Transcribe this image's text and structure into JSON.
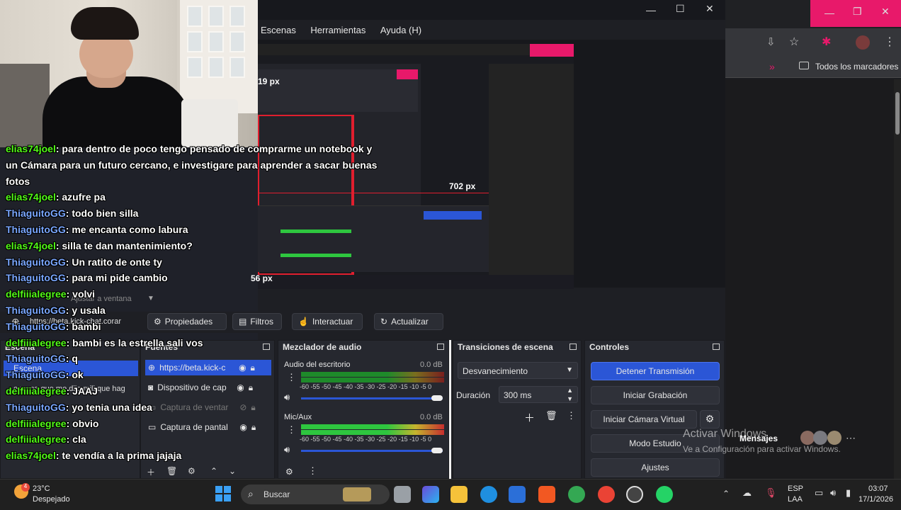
{
  "obs": {
    "menu": [
      "Escenas",
      "Herramientas",
      "Ayuda (H)"
    ],
    "measure_labels": {
      "left": "19 px",
      "right": "702 px",
      "bottom": "56 px"
    },
    "fit_label": "Ajustar a ventana",
    "source_url_label": "https://beta.kick-chat.corar",
    "toolbar": {
      "properties": "Propiedades",
      "filters": "Filtros",
      "interact": "Interactuar",
      "refresh": "Actualizar"
    },
    "scenes_panel": {
      "title": "Escena",
      "item": "Escena",
      "desc": "escena que me dijo mili que hag"
    },
    "sources_panel": {
      "title": "Fuentes",
      "items": [
        "https://beta.kick-c",
        "Dispositivo de cap",
        "Captura de ventar",
        "Captura de pantal"
      ]
    },
    "mixer": {
      "title": "Mezclador de audio",
      "channels": [
        {
          "name": "Audio del escritorio",
          "db": "0.0 dB"
        },
        {
          "name": "Mic/Aux",
          "db": "0.0 dB"
        }
      ],
      "scale": "-60 -55 -50 -45 -40 -35 -30 -25 -20 -15 -10 -5 0"
    },
    "transitions": {
      "title": "Transiciones de escena",
      "selected": "Desvanecimiento",
      "duration_label": "Duración",
      "duration_value": "300 ms"
    },
    "controls": {
      "title": "Controles",
      "stop_stream": "Detener Transmisión",
      "start_recording": "Iniciar Grabación",
      "virtual_cam": "Iniciar Cámara Virtual",
      "studio_mode": "Modo Estudio",
      "settings": "Ajustes"
    }
  },
  "browser": {
    "bookmarks_label": "Todos los marcadores"
  },
  "watermark": {
    "title": "Activar Windows",
    "subtitle": "Ve a Configuración para activar Windows.",
    "messages": "Mensajes"
  },
  "chat": [
    {
      "user": "elias74joel",
      "text": "para dentro de poco tengo pensado de comprarme un notebook y",
      "color": "green"
    },
    {
      "user": "",
      "text": "un Cámara para un futuro cercano, e investigare para aprender a sacar buenas",
      "color": "green"
    },
    {
      "user": "",
      "text": "fotos",
      "color": "green"
    },
    {
      "user": "elias74joel",
      "text": "azufre pa",
      "color": "green"
    },
    {
      "user": "ThiaguitoGG",
      "text": "todo bien silla",
      "color": "green"
    },
    {
      "user": "ThiaguitoGG",
      "text": "me encanta como labura",
      "color": "green"
    },
    {
      "user": "elias74joel",
      "text": "silla te dan mantenimiento?",
      "color": "green"
    },
    {
      "user": "ThiaguitoGG",
      "text": "Un ratito de onte ty",
      "color": "green"
    },
    {
      "user": "ThiaguitoGG",
      "text": "para mi pide cambio",
      "color": "green"
    },
    {
      "user": "delfiiialegree",
      "text": "volvi",
      "color": "green"
    },
    {
      "user": "ThiaguitoGG",
      "text": "y usala",
      "color": "green"
    },
    {
      "user": "ThiaguitoGG",
      "text": "bambi",
      "color": "green"
    },
    {
      "user": "delfiiialegree",
      "text": "bambi es la estrella sali vos",
      "color": "green"
    },
    {
      "user": "ThiaguitoGG",
      "text": "q",
      "color": "green"
    },
    {
      "user": "ThiaguitoGG",
      "text": "ok",
      "color": "green"
    },
    {
      "user": "delfiiialegree",
      "text": "JAAJ",
      "color": "green"
    },
    {
      "user": "ThiaguitoGG",
      "text": "yo tenia una idea",
      "color": "green"
    },
    {
      "user": "delfiiialegree",
      "text": "obvio",
      "color": "green"
    },
    {
      "user": "delfiiialegree",
      "text": "cla",
      "color": "green"
    },
    {
      "user": "elias74joel",
      "text": "te vendía a la prima jajaja",
      "color": "green"
    }
  ],
  "taskbar": {
    "weather_temp": "23°C",
    "weather_desc": "Despejado",
    "weather_badge": "4",
    "search": "Buscar",
    "lang": "ESP",
    "lang2": "LAA",
    "time": "03:07",
    "date": "17/1/2026"
  }
}
